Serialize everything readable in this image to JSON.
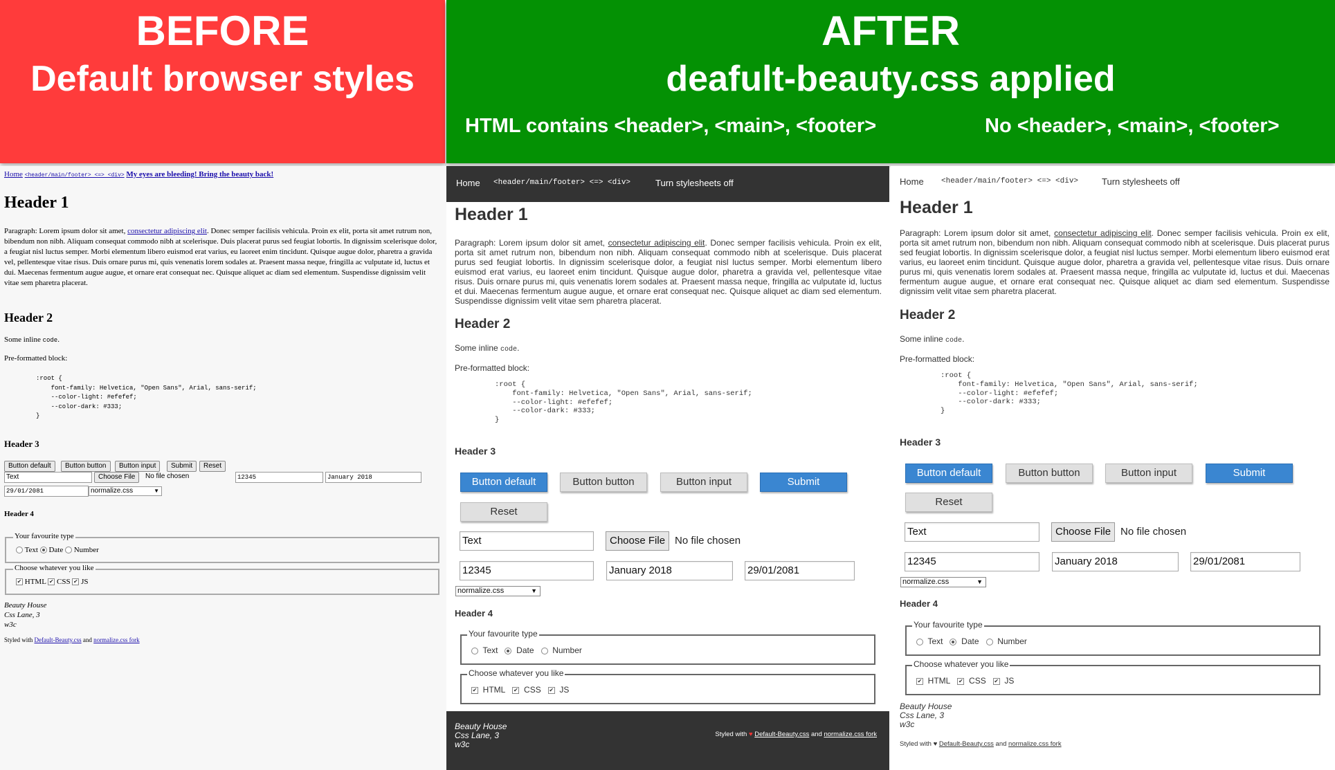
{
  "banners": {
    "before": {
      "line1": "BEFORE",
      "line2": "Default browser styles",
      "color": "#ff3b3b"
    },
    "after": {
      "line1": "AFTER",
      "line2": "deafult-beauty.css applied",
      "sub_left": "HTML contains <header>, <main>, <footer>",
      "sub_right": "No <header>, <main>, <footer>",
      "color": "#049104"
    }
  },
  "nav": {
    "home": "Home",
    "toggle": "<header/main/footer> <=> <div>",
    "bleeding": "My eyes are bleeding! Bring the beauty back!",
    "stylesheets_off": "Turn stylesheets off"
  },
  "content": {
    "h1": "Header 1",
    "paragraph_prefix": "Paragraph: Lorem ipsum dolor sit amet, ",
    "paragraph_link": "consectetur adipiscing elit",
    "paragraph_rest": ". Donec semper facilisis vehicula. Proin ex elit, porta sit amet rutrum non, bibendum non nibh. Aliquam consequat commodo nibh at scelerisque. Duis placerat purus sed feugiat lobortis. In dignissim scelerisque dolor, a feugiat nisl luctus semper. Morbi elementum libero euismod erat varius, eu laoreet enim tincidunt. Quisque augue dolor, pharetra a gravida vel, pellentesque vitae risus. Duis ornare purus mi, quis venenatis lorem sodales at. Praesent massa neque, fringilla ac vulputate id, luctus et dui. Maecenas fermentum augue augue, et ornare erat consequat nec. Quisque aliquet ac diam sed elementum. Suspendisse dignissim velit vitae sem pharetra placerat.",
    "h2": "Header 2",
    "inline_prefix": "Some inline ",
    "inline_code": "code",
    "inline_suffix": ".",
    "pre_label": "Pre-formatted block:",
    "pre_code": ":root {\n    font-family: Helvetica, \"Open Sans\", Arial, sans-serif;\n    --color-light: #efefef;\n    --color-dark: #333;\n}",
    "h3": "Header 3",
    "h4": "Header 4"
  },
  "form": {
    "btn_default": "Button default",
    "btn_button": "Button button",
    "btn_input": "Button input",
    "btn_submit": "Submit",
    "btn_reset": "Reset",
    "text_value": "Text",
    "file_button": "Choose File",
    "file_status": "No file chosen",
    "number_value": "12345",
    "month_value": "January 2018",
    "date_value": "29/01/2081",
    "select_value": "normalize.css",
    "select_arrow": "▼",
    "fieldset1_legend": "Your favourite type",
    "radio_text": "Text",
    "radio_date": "Date",
    "radio_number": "Number",
    "fieldset2_legend": "Choose whatever you like",
    "check_html": "HTML",
    "check_css": "CSS",
    "check_js": "JS",
    "check_mark": "✔"
  },
  "footer": {
    "addr1": "Beauty House",
    "addr2": "Css Lane, 3",
    "addr3": "w3c",
    "styled_with": "Styled with",
    "heart": "♥",
    "link1": "Default-Beauty.css",
    "and": "and",
    "link2": "normalize.css fork"
  }
}
